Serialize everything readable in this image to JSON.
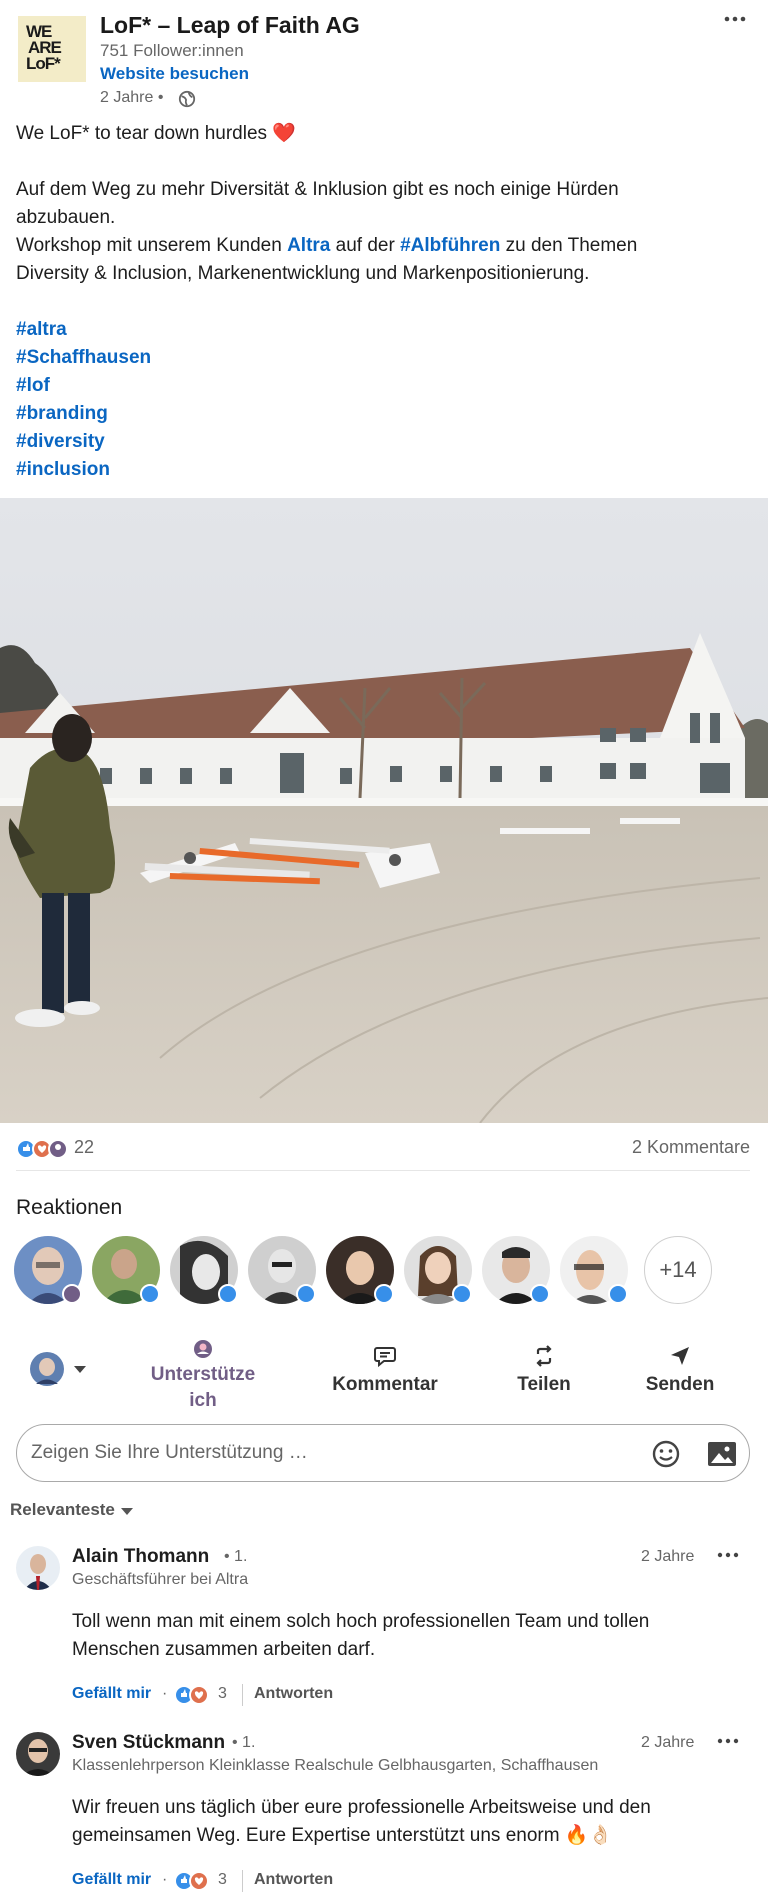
{
  "company": {
    "name": "LoF* – Leap of Faith AG",
    "logo_text": "WE ARE LoF*",
    "followers": "751 Follower:innen",
    "website_link": "Website besuchen",
    "post_time": "2 Jahre •"
  },
  "post": {
    "line1": "We LoF* to tear down hurdles",
    "line1_emoji": "❤️",
    "line2": "Auf dem Weg zu mehr Diversität & Inklusion gibt es noch einige Hürden",
    "line3": "abzubauen.",
    "line4_a": "Workshop mit unserem Kunden ",
    "line4_link1": "Altra",
    "line4_b": " auf der ",
    "line4_link2": "#Albführen",
    "line4_c": " zu den Themen",
    "line5": "Diversity & Inclusion, Markenentwicklung und Markenpositionierung.",
    "hashtags": [
      "#altra",
      "#Schaffhausen",
      "#lof",
      "#branding",
      "#diversity",
      "#inclusion"
    ]
  },
  "stats": {
    "reaction_count": "22",
    "comment_count": "2 Kommentare"
  },
  "reactions": {
    "heading": "Reaktionen",
    "more": "+14"
  },
  "actions": {
    "support_line1": "Unterstütze",
    "support_line2": "ich",
    "comment": "Kommentar",
    "share": "Teilen",
    "send": "Senden"
  },
  "comment_input": {
    "placeholder": "Zeigen Sie Ihre Unterstützung …"
  },
  "sort": {
    "label": "Relevanteste"
  },
  "comments": [
    {
      "name": "Alain Thomann",
      "degree": "• 1.",
      "headline": "Geschäftsführer bei Altra",
      "time": "2 Jahre",
      "text_line1": "Toll wenn man mit einem solch hoch professionellen Team und tollen",
      "text_line2": "Menschen zusammen arbeiten darf.",
      "like_label": "Gefällt mir",
      "dot": "·",
      "reaction_count": "3",
      "reply_label": "Antworten"
    },
    {
      "name": "Sven Stückmann",
      "degree": "• 1.",
      "headline": "Klassenlehrperson Kleinklasse Realschule Gelbhausgarten, Schaffhausen",
      "time": "2 Jahre",
      "text_line1": "Wir freuen uns täglich über eure professionelle Arbeitsweise und den",
      "text_line2": "gemeinsamen Weg. Eure Expertise unterstützt uns enorm 🔥👌🏻",
      "like_label": "Gefällt mir",
      "dot": "·",
      "reaction_count": "3",
      "reply_label": "Antworten"
    }
  ],
  "colors": {
    "link_blue": "#0a66c2",
    "support_purple": "#715e86",
    "text_dark": "#1d1d1d",
    "text_muted": "#666666"
  }
}
